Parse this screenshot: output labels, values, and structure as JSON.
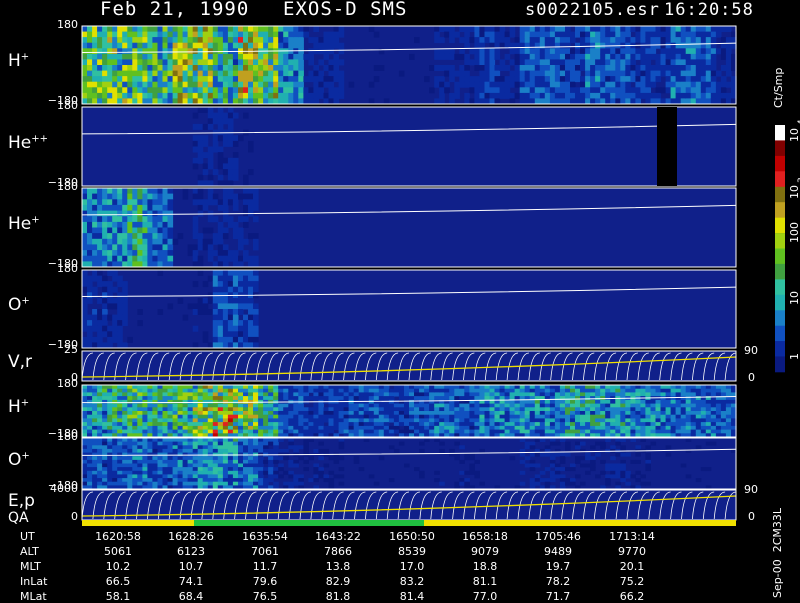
{
  "header": {
    "date": "Feb 21, 1990",
    "instrument": "EXOS-D SMS",
    "file": "s0022105.esr",
    "time": "16:20:58"
  },
  "colorbar": {
    "unit": "Ct/Smp",
    "labels": [
      "1",
      "10",
      "100",
      "10",
      "3",
      "10",
      "4"
    ],
    "colors": [
      "#0a1a80",
      "#0a2aa0",
      "#1050c0",
      "#1a80c8",
      "#20b0b0",
      "#30c0a0",
      "#40a040",
      "#60c020",
      "#a0d010",
      "#e0e000",
      "#c0a020",
      "#807010",
      "#e02020",
      "#c00000",
      "#800000",
      "#ffffff"
    ]
  },
  "panels": [
    {
      "ion": "H",
      "charge": "+",
      "ymax": "180",
      "ymin": "−180"
    },
    {
      "ion": "He",
      "charge": "++",
      "ymax": "180",
      "ymin": "−180"
    },
    {
      "ion": "He",
      "charge": "+",
      "ymax": "180",
      "ymin": "−180"
    },
    {
      "ion": "O",
      "charge": "+",
      "ymax": "180",
      "ymin": "−180"
    },
    {
      "ion": "V,r",
      "charge": "",
      "ymax": "25",
      "ymin": "0",
      "right_top": "90",
      "right_bottom": "0"
    },
    {
      "ion": "H",
      "charge": "+",
      "ymax": "180",
      "ymin": "−180"
    },
    {
      "ion": "O",
      "charge": "+",
      "ymax": "180",
      "ymin": "−180"
    },
    {
      "ion": "E,p",
      "charge": "",
      "ymax": "4000",
      "ymin": "0",
      "right_top": "90",
      "right_bottom": "0"
    }
  ],
  "qa_label": "QA",
  "side_note": "Sep-00  2CM33L",
  "table": {
    "rows": [
      {
        "label": "UT",
        "values": [
          "1620:58",
          "1628:26",
          "1635:54",
          "1643:22",
          "1650:50",
          "1658:18",
          "1705:46",
          "1713:14"
        ]
      },
      {
        "label": "ALT",
        "values": [
          "5061",
          "6123",
          "7061",
          "7866",
          "8539",
          "9079",
          "9489",
          "9770"
        ]
      },
      {
        "label": "MLT",
        "values": [
          "10.2",
          "10.7",
          "11.7",
          "13.8",
          "17.0",
          "18.8",
          "19.7",
          "20.1"
        ]
      },
      {
        "label": "InLat",
        "values": [
          "66.5",
          "74.1",
          "79.6",
          "82.9",
          "83.2",
          "81.1",
          "78.2",
          "75.2"
        ]
      },
      {
        "label": "MLat",
        "values": [
          "58.1",
          "68.4",
          "76.5",
          "81.8",
          "81.4",
          "77.0",
          "71.7",
          "66.2"
        ]
      }
    ]
  },
  "chart_data": {
    "type": "heatmap",
    "x": [
      "1620:58",
      "1628:26",
      "1635:54",
      "1643:22",
      "1650:50",
      "1658:18",
      "1705:46",
      "1713:14"
    ],
    "series": [
      {
        "name": "H+",
        "y_range": [
          -180,
          180
        ],
        "intensity_profile": [
          0.55,
          0.6,
          0.55,
          0.5,
          0.65,
          0.7,
          0.45,
          0.7,
          0.65,
          0.3,
          0.1,
          0.1,
          0.05,
          0.05,
          0.05,
          0.05,
          0.1,
          0.1,
          0.15,
          0.1,
          0.2,
          0.2,
          0.15,
          0.25,
          0.2,
          0.15,
          0.15,
          0.25,
          0.2,
          0.1
        ]
      },
      {
        "name": "He++",
        "y_range": [
          -180,
          180
        ],
        "intensity_profile": [
          0.02,
          0.02,
          0.02,
          0.02,
          0.02,
          0.08,
          0.1,
          0.05,
          0.02,
          0.02,
          0.02,
          0.02,
          0.02,
          0.02,
          0.02,
          0.02,
          0.02,
          0.02,
          0.02,
          0.02,
          0.02,
          0.02,
          0.02,
          0.02,
          0.02,
          0.02,
          0.02,
          0.02,
          0.02,
          0.02
        ]
      },
      {
        "name": "He+",
        "y_range": [
          -180,
          180
        ],
        "intensity_profile": [
          0.3,
          0.35,
          0.45,
          0.25,
          0.05,
          0.08,
          0.1,
          0.1,
          0.02,
          0.02,
          0.02,
          0.02,
          0.02,
          0.02,
          0.02,
          0.02,
          0.02,
          0.02,
          0.02,
          0.02,
          0.02,
          0.02,
          0.02,
          0.02,
          0.02,
          0.02,
          0.02,
          0.02,
          0.02,
          0.02
        ]
      },
      {
        "name": "O+",
        "y_range": [
          -180,
          180
        ],
        "intensity_profile": [
          0.12,
          0.1,
          0.05,
          0.04,
          0.04,
          0.06,
          0.2,
          0.15,
          0.03,
          0.02,
          0.02,
          0.02,
          0.02,
          0.02,
          0.02,
          0.02,
          0.02,
          0.02,
          0.02,
          0.02,
          0.02,
          0.02,
          0.02,
          0.02,
          0.02,
          0.02,
          0.02,
          0.02,
          0.02,
          0.02
        ]
      },
      {
        "name": "H+ (lower)",
        "y_range": [
          -180,
          180
        ],
        "intensity_profile": [
          0.4,
          0.45,
          0.5,
          0.45,
          0.5,
          0.65,
          0.75,
          0.6,
          0.45,
          0.2,
          0.15,
          0.15,
          0.2,
          0.2,
          0.15,
          0.2,
          0.25,
          0.2,
          0.3,
          0.3,
          0.35,
          0.3,
          0.4,
          0.4,
          0.35,
          0.3,
          0.3,
          0.25,
          0.25,
          0.2
        ]
      },
      {
        "name": "O+ (lower)",
        "y_range": [
          -180,
          180
        ],
        "intensity_profile": [
          0.2,
          0.2,
          0.25,
          0.2,
          0.25,
          0.3,
          0.35,
          0.25,
          0.15,
          0.08,
          0.06,
          0.06,
          0.05,
          0.05,
          0.05,
          0.05,
          0.06,
          0.06,
          0.05,
          0.05,
          0.08,
          0.08,
          0.06,
          0.06,
          0.08,
          0.06,
          0.05,
          0.05,
          0.05,
          0.05
        ]
      }
    ]
  }
}
